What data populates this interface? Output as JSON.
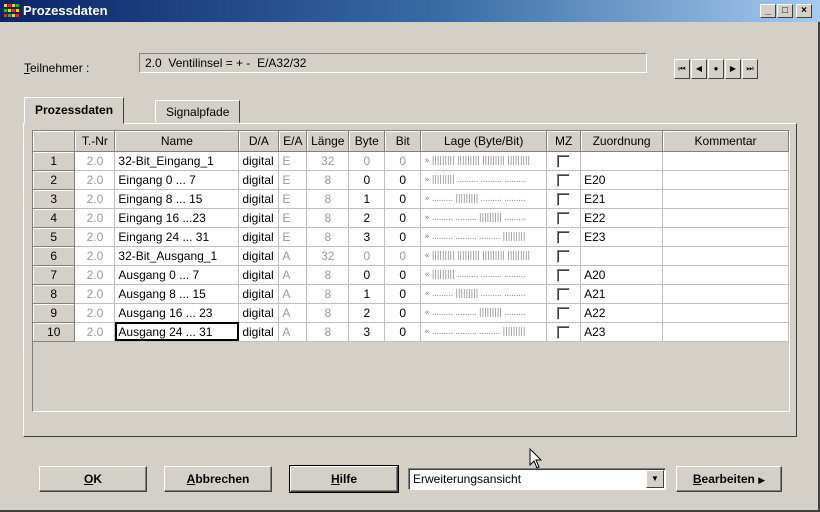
{
  "window": {
    "title": "Prozessdaten"
  },
  "titlebar_buttons": {
    "minimize": "_",
    "maximize": "□",
    "close": "×"
  },
  "teilnehmer": {
    "label_prefix": "T",
    "label_rest": "eilnehmer :",
    "value": "2.0  Ventilinsel = + -  E/A32/32"
  },
  "nav_buttons": [
    "⏮",
    "◀",
    "●",
    "▶",
    "⏭"
  ],
  "tabs": [
    {
      "label": "Prozessdaten",
      "active": true
    },
    {
      "label": "Signalpfade",
      "active": false
    }
  ],
  "table": {
    "columns": [
      "",
      "T.-Nr",
      "Name",
      "D/A",
      "E/A",
      "Länge",
      "Byte",
      "Bit",
      "Lage (Byte/Bit)",
      "MZ",
      "Zuordnung",
      "Kommentar"
    ],
    "rows": [
      {
        "nr": "1",
        "tnr": "2.0",
        "name": "32-Bit_Eingang_1",
        "da": "digital",
        "ea": "E",
        "laenge": "32",
        "byte": "0",
        "bit": "0",
        "lage": "» ||||||||| ||||||||| ||||||||| |||||||||",
        "zuordnung": "",
        "kommentar": ""
      },
      {
        "nr": "2",
        "tnr": "2.0",
        "name": "Eingang 0 ... 7",
        "da": "digital",
        "ea": "E",
        "laenge": "8",
        "byte": "0",
        "bit": "0",
        "lage": "» ||||||||| ......... ......... .........",
        "zuordnung": "E20",
        "kommentar": ""
      },
      {
        "nr": "3",
        "tnr": "2.0",
        "name": "Eingang 8 ... 15",
        "da": "digital",
        "ea": "E",
        "laenge": "8",
        "byte": "1",
        "bit": "0",
        "lage": "» ......... ||||||||| ......... .........",
        "zuordnung": "E21",
        "kommentar": ""
      },
      {
        "nr": "4",
        "tnr": "2.0",
        "name": "Eingang 16 ...23",
        "da": "digital",
        "ea": "E",
        "laenge": "8",
        "byte": "2",
        "bit": "0",
        "lage": "» ......... ......... ||||||||| .........",
        "zuordnung": "E22",
        "kommentar": ""
      },
      {
        "nr": "5",
        "tnr": "2.0",
        "name": "Eingang 24 ... 31",
        "da": "digital",
        "ea": "E",
        "laenge": "8",
        "byte": "3",
        "bit": "0",
        "lage": "» ......... ......... ......... |||||||||",
        "zuordnung": "E23",
        "kommentar": ""
      },
      {
        "nr": "6",
        "tnr": "2.0",
        "name": "32-Bit_Ausgang_1",
        "da": "digital",
        "ea": "A",
        "laenge": "32",
        "byte": "0",
        "bit": "0",
        "lage": "« ||||||||| ||||||||| ||||||||| |||||||||",
        "zuordnung": "",
        "kommentar": ""
      },
      {
        "nr": "7",
        "tnr": "2.0",
        "name": "Ausgang 0 ... 7",
        "da": "digital",
        "ea": "A",
        "laenge": "8",
        "byte": "0",
        "bit": "0",
        "lage": "« ||||||||| ......... ......... .........",
        "zuordnung": "A20",
        "kommentar": ""
      },
      {
        "nr": "8",
        "tnr": "2.0",
        "name": "Ausgang 8 ... 15",
        "da": "digital",
        "ea": "A",
        "laenge": "8",
        "byte": "1",
        "bit": "0",
        "lage": "« ......... ||||||||| ......... .........",
        "zuordnung": "A21",
        "kommentar": ""
      },
      {
        "nr": "9",
        "tnr": "2.0",
        "name": "Ausgang 16 ... 23",
        "da": "digital",
        "ea": "A",
        "laenge": "8",
        "byte": "2",
        "bit": "0",
        "lage": "« ......... ......... ||||||||| .........",
        "zuordnung": "A22",
        "kommentar": ""
      },
      {
        "nr": "10",
        "tnr": "2.0",
        "name": "Ausgang 24 ... 31",
        "da": "digital",
        "ea": "A",
        "laenge": "8",
        "byte": "3",
        "bit": "0",
        "lage": "« ......... ......... ......... |||||||||",
        "zuordnung": "A23",
        "kommentar": ""
      }
    ]
  },
  "buttons": {
    "ok_first": "O",
    "ok_rest": "K",
    "abbrechen_first": "A",
    "abbrechen_rest": "bbrechen",
    "hilfe_first": "H",
    "hilfe_rest": "ilfe",
    "bearbeiten_first": "B",
    "bearbeiten_rest": "earbeiten",
    "bearbeiten_arrow": "▶"
  },
  "view_select": {
    "value": "Erweiterungsansicht",
    "arrow": "▼"
  },
  "colors": {
    "titlebar_start": "#0a246a",
    "titlebar_end": "#a6caf0",
    "face": "#d4d0c8"
  }
}
